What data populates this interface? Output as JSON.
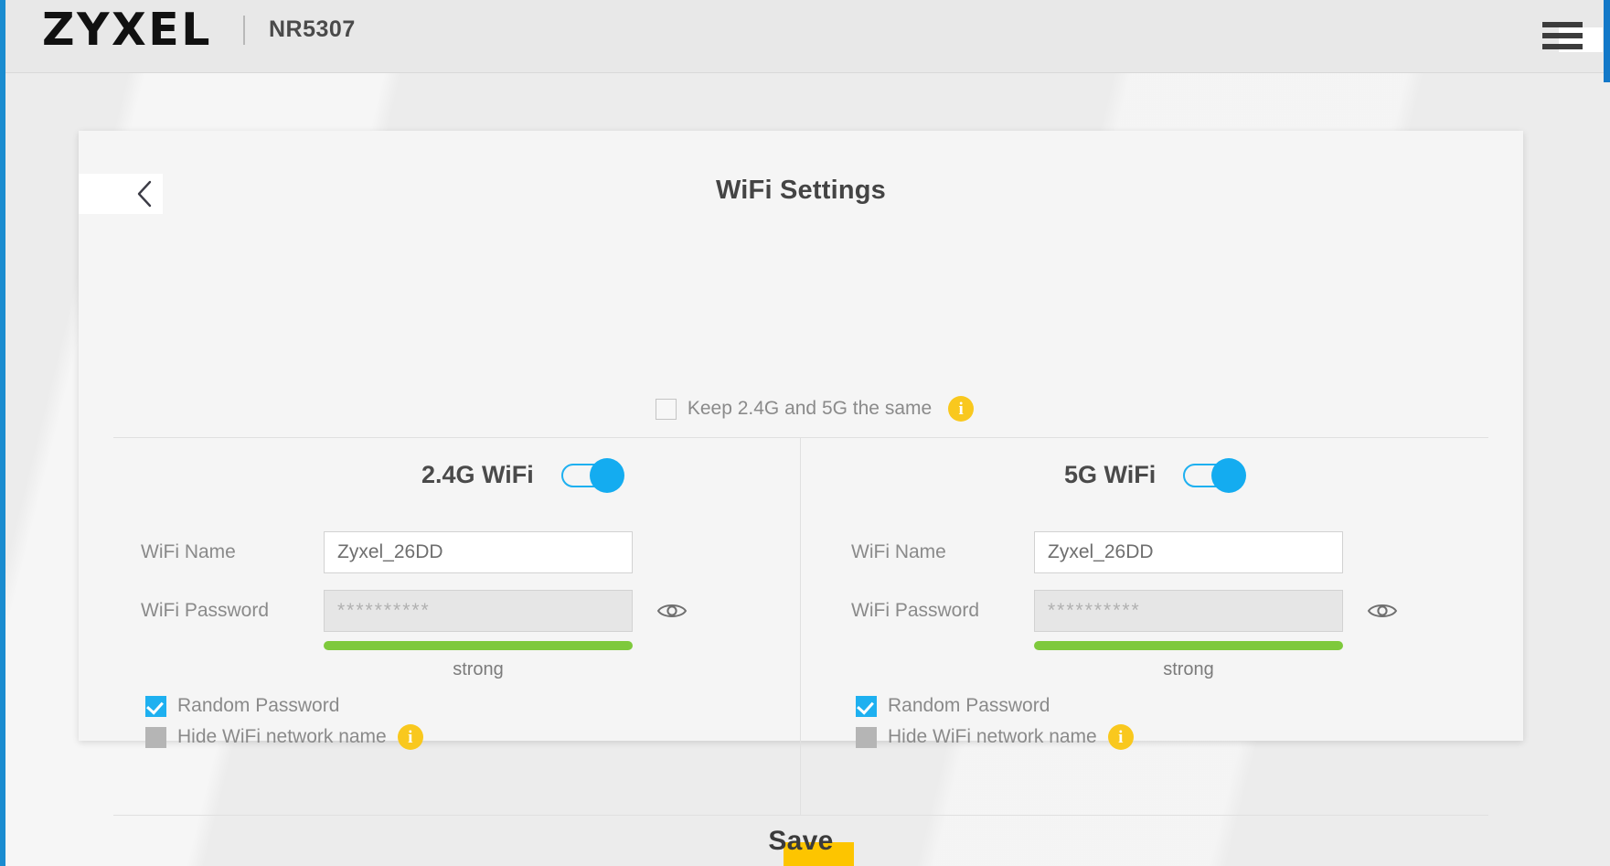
{
  "header": {
    "brand": "ZYXEL",
    "model": "NR5307",
    "menu_icon": "hamburger-menu-icon"
  },
  "card": {
    "back_icon": "chevron-left-icon",
    "title": "WiFi Settings",
    "keep_same": {
      "label": "Keep 2.4G and 5G the same",
      "checked": false,
      "info_glyph": "i"
    },
    "save_label": "Save"
  },
  "bands": [
    {
      "key": "band24",
      "title": "2.4G WiFi",
      "enabled": true,
      "wifi_name_label": "WiFi Name",
      "wifi_name_value": "Zyxel_26DD",
      "wifi_password_label": "WiFi Password",
      "wifi_password_value": "**********",
      "password_disabled": true,
      "reveal_icon": "eye-icon",
      "strength_text": "strong",
      "strength_percent": 100,
      "options": [
        {
          "label": "Random Password",
          "state": "checked",
          "info": false
        },
        {
          "label": "Hide WiFi network name",
          "state": "disabled",
          "info": true,
          "info_glyph": "i"
        }
      ]
    },
    {
      "key": "band5",
      "title": "5G WiFi",
      "enabled": true,
      "wifi_name_label": "WiFi Name",
      "wifi_name_value": "Zyxel_26DD",
      "wifi_password_label": "WiFi Password",
      "wifi_password_value": "**********",
      "password_disabled": true,
      "reveal_icon": "eye-icon",
      "strength_text": "strong",
      "strength_percent": 100,
      "options": [
        {
          "label": "Random Password",
          "state": "checked",
          "info": false
        },
        {
          "label": "Hide WiFi network name",
          "state": "disabled",
          "info": true,
          "info_glyph": "i"
        }
      ]
    }
  ],
  "colors": {
    "accent_blue": "#14acf0",
    "edge_blue": "#1a8cd0",
    "info_yellow": "#f9c81e",
    "save_highlight": "#fdc500",
    "strength_green": "#7ec93c",
    "page_bg": "#ececec",
    "card_bg": "#f5f5f5",
    "topbar_bg": "#e8e8e8"
  }
}
